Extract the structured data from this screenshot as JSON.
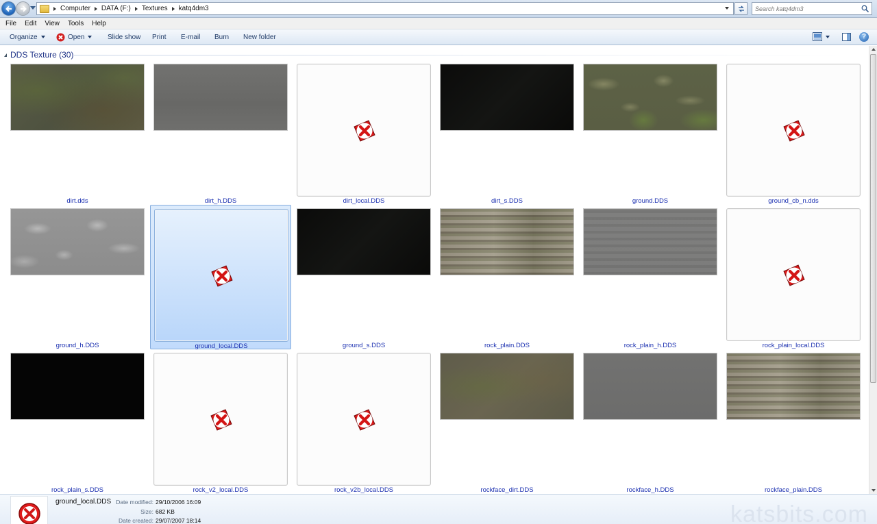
{
  "address": {
    "breadcrumbs": [
      "Computer",
      "DATA (F:)",
      "Textures",
      "katq4dm3"
    ],
    "search_placeholder": "Search katq4dm3"
  },
  "menu": [
    "File",
    "Edit",
    "View",
    "Tools",
    "Help"
  ],
  "toolbar": {
    "organize": "Organize",
    "open": "Open",
    "slideshow": "Slide show",
    "print": "Print",
    "email": "E-mail",
    "burn": "Burn",
    "new_folder": "New folder"
  },
  "group": {
    "label": "DDS Texture (30)"
  },
  "files": [
    {
      "name": "dirt.dds",
      "thumb": "dirt"
    },
    {
      "name": "dirt_h.DDS",
      "thumb": "grey"
    },
    {
      "name": "dirt_local.DDS",
      "thumb": "error"
    },
    {
      "name": "dirt_s.DDS",
      "thumb": "dark"
    },
    {
      "name": "ground.DDS",
      "thumb": "ground"
    },
    {
      "name": "ground_cb_n.dds",
      "thumb": "error"
    },
    {
      "name": "ground_h.DDS",
      "thumb": "ground-h"
    },
    {
      "name": "ground_local.DDS",
      "thumb": "error",
      "selected": true
    },
    {
      "name": "ground_s.DDS",
      "thumb": "dark"
    },
    {
      "name": "rock_plain.DDS",
      "thumb": "rock"
    },
    {
      "name": "rock_plain_h.DDS",
      "thumb": "rock-h"
    },
    {
      "name": "rock_plain_local.DDS",
      "thumb": "error"
    },
    {
      "name": "rock_plain_s.DDS",
      "thumb": "black"
    },
    {
      "name": "rock_v2_local.DDS",
      "thumb": "error"
    },
    {
      "name": "rock_v2b_local.DDS",
      "thumb": "error"
    },
    {
      "name": "rockface_dirt.DDS",
      "thumb": "rockface-dirt"
    },
    {
      "name": "rockface_h.DDS",
      "thumb": "rockface-h"
    },
    {
      "name": "rockface_plain.DDS",
      "thumb": "rock"
    }
  ],
  "details": {
    "filename": "ground_local.DDS",
    "date_modified_label": "Date modified:",
    "date_modified": "29/10/2006 16:09",
    "size_label": "Size:",
    "size": "682 KB",
    "date_created_label": "Date created:",
    "date_created": "29/07/2007 18:14"
  },
  "watermark": "katsbits.com",
  "colors": {
    "accent_link": "#1a2fb0",
    "group_header": "#1e3287",
    "selection": "#c1dbfc"
  }
}
